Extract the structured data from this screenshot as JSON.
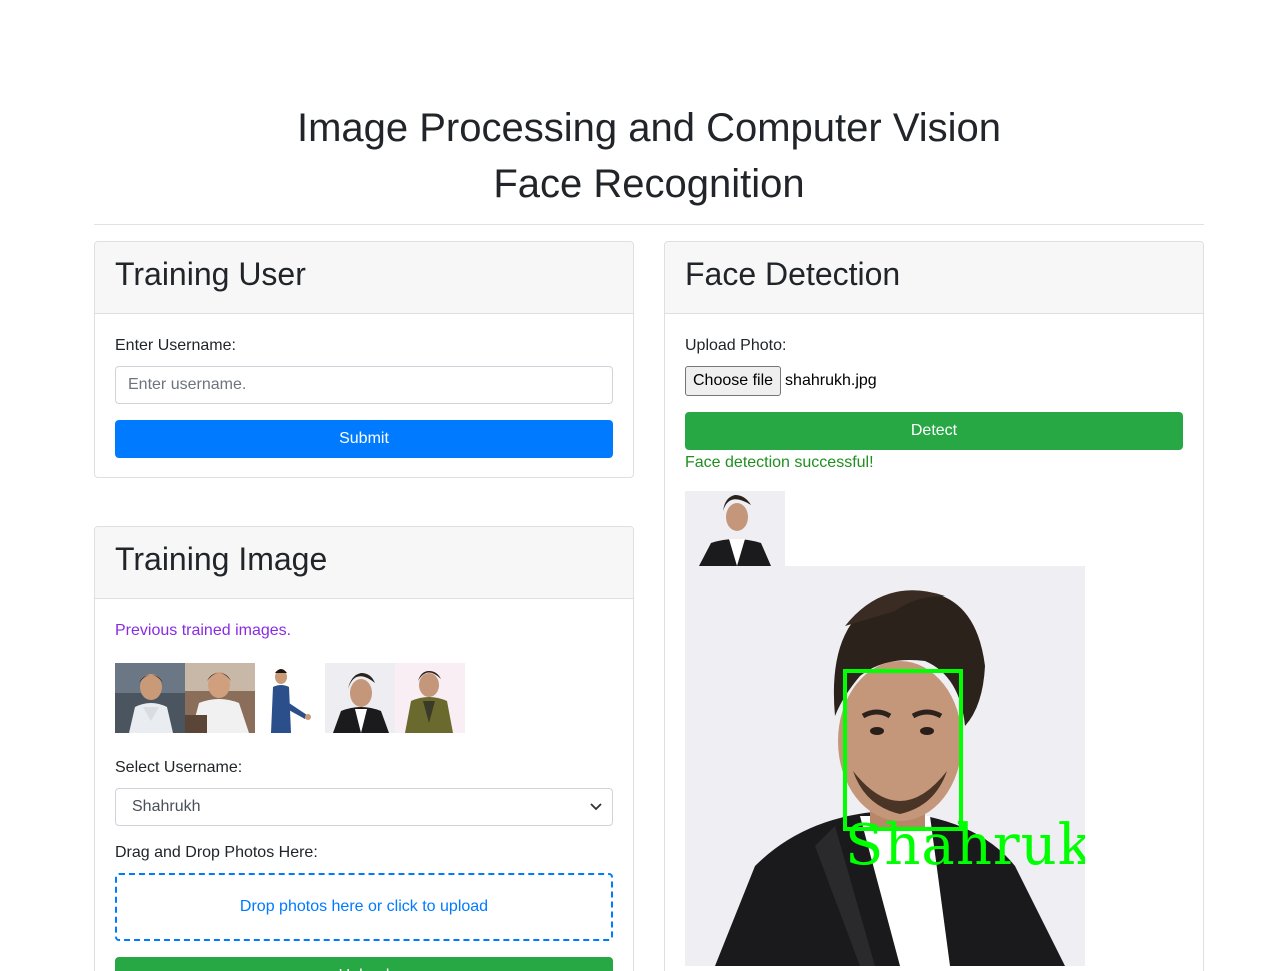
{
  "header": {
    "title_line1": "Image Processing and Computer Vision",
    "title_line2": "Face Recognition"
  },
  "training_user": {
    "title": "Training User",
    "username_label": "Enter Username:",
    "username_placeholder": "Enter username.",
    "submit_label": "Submit"
  },
  "training_image": {
    "title": "Training Image",
    "previous_text": "Previous trained images.",
    "select_label": "Select Username:",
    "selected_user": "Shahrukh",
    "dragdrop_label": "Drag and Drop Photos Here:",
    "dropzone_text": "Drop photos here or click to upload",
    "upload_label": "Upload",
    "thumbnails": [
      "trained-image-1",
      "trained-image-2",
      "trained-image-3",
      "trained-image-4",
      "trained-image-5"
    ]
  },
  "face_detection": {
    "title": "Face Detection",
    "upload_label": "Upload Photo:",
    "choose_file_label": "Choose file",
    "file_name": "shahrukh.jpg",
    "detect_label": "Detect",
    "status_text": "Face detection successful!",
    "detected_name": "Shahruk"
  },
  "colors": {
    "primary": "#007bff",
    "success": "#28a745",
    "previous_text": "#8a2be2",
    "detection_box": "#00ff00"
  }
}
